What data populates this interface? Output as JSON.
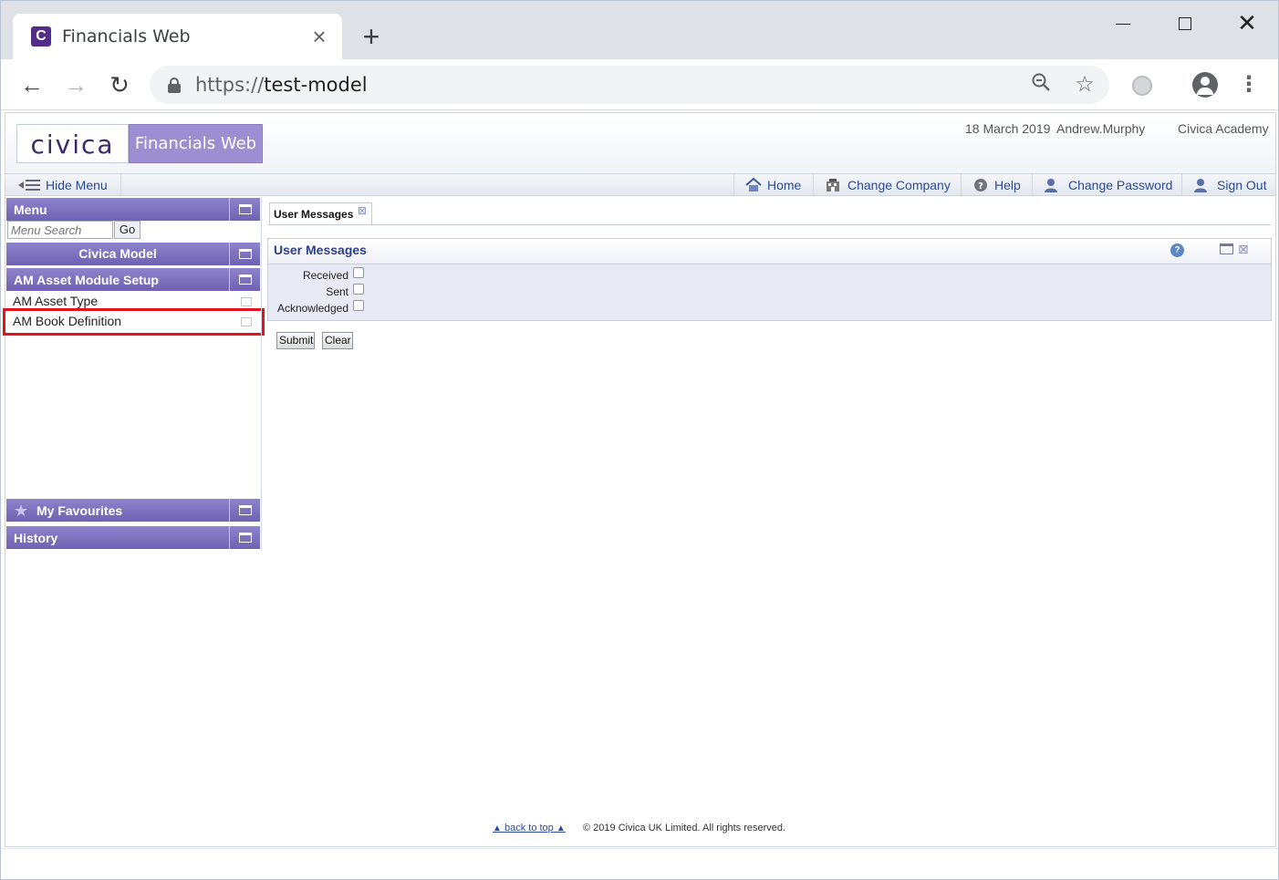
{
  "browser": {
    "tab_title": "Financials Web",
    "favicon_letter": "C",
    "url_scheme": "https://",
    "url_host": "test-model",
    "icons": [
      "back-arrow-icon",
      "forward-arrow-icon",
      "reload-icon",
      "lock-icon",
      "zoom-icon",
      "star-icon",
      "extension-icon",
      "profile-icon",
      "menu-kebab-icon",
      "new-tab-icon",
      "close-icon",
      "minimize-icon",
      "maximize-icon"
    ]
  },
  "header": {
    "logo_text": "civica",
    "brand_text": "Financials Web",
    "date": "18 March 2019",
    "user": "Andrew.Murphy",
    "organisation": "Civica Academy"
  },
  "menubar": {
    "hide_menu": "Hide Menu",
    "items": [
      {
        "label": "Home",
        "icon": "home-icon"
      },
      {
        "label": "Change Company",
        "icon": "building-icon"
      },
      {
        "label": "Help",
        "icon": "help-icon"
      },
      {
        "label": "Change Password",
        "icon": "user-key-icon"
      },
      {
        "label": "Sign Out",
        "icon": "sign-out-icon"
      }
    ]
  },
  "sidebar": {
    "menu_title": "Menu",
    "search_placeholder": "Menu Search",
    "go_label": "Go",
    "company_title": "Civica Model",
    "section_title": "AM Asset Module Setup",
    "links": [
      "AM Asset Type",
      "AM Book Definition"
    ],
    "highlighted_link": "AM Book Definition",
    "highlight_color": "#e3141f",
    "favourites_title": "My Favourites",
    "history_title": "History"
  },
  "main": {
    "tab_label": "User Messages",
    "panel_title": "User Messages",
    "fields": [
      {
        "label": "Received",
        "checked": false
      },
      {
        "label": "Sent",
        "checked": false
      },
      {
        "label": "Acknowledged",
        "checked": false
      }
    ],
    "submit_label": "Submit",
    "clear_label": "Clear"
  },
  "footer": {
    "back_to_top": "back to top",
    "copyright": "© 2019 Civica UK Limited. All rights reserved."
  },
  "colors": {
    "accent_purple": "#6f62b3",
    "brand_purple": "#9c8ed0",
    "link_blue": "#2a4b9b",
    "panel_body": "#e8ebf6"
  }
}
